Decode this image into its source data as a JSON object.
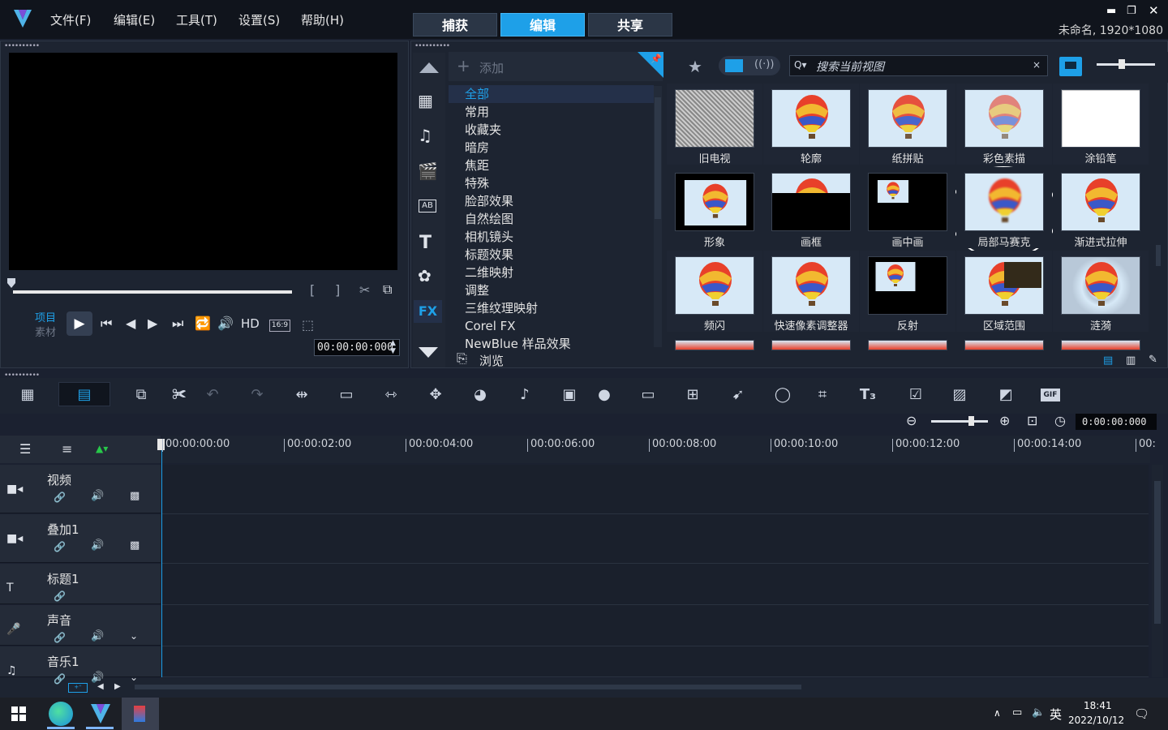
{
  "app": {
    "logo": "V",
    "title": "未命名, 1920*1080"
  },
  "menu": [
    "文件(F)",
    "编辑(E)",
    "工具(T)",
    "设置(S)",
    "帮助(H)"
  ],
  "modes": [
    {
      "label": "捕获",
      "active": false
    },
    {
      "label": "编辑",
      "active": true
    },
    {
      "label": "共享",
      "active": false
    }
  ],
  "window_controls": [
    "minimize-icon",
    "restore-icon",
    "close-icon"
  ],
  "player": {
    "project_label": "项目",
    "clip_label": "素材",
    "timecode": "00:00:00:000",
    "hd": "HD",
    "aspect": "16:9"
  },
  "library": {
    "add_label": "添加",
    "browse_label": "浏览",
    "categories": [
      "全部",
      "常用",
      "收藏夹",
      "暗房",
      "焦距",
      "特殊",
      "脸部效果",
      "自然绘图",
      "相机镜头",
      "标题效果",
      "二维映射",
      "调整",
      "三维纹理映射",
      "Corel FX",
      "NewBlue 样品效果"
    ],
    "selected_category": "全部",
    "search_placeholder": "搜索当前视图",
    "fx_label": "FX",
    "thumbnails": [
      {
        "label": "旧电视",
        "style": "noise"
      },
      {
        "label": "轮廓",
        "style": "balloon"
      },
      {
        "label": "纸拼贴",
        "style": "paper"
      },
      {
        "label": "彩色素描",
        "style": "sketch"
      },
      {
        "label": "涂铅笔",
        "style": "pencil"
      },
      {
        "label": "形象",
        "style": "framed"
      },
      {
        "label": "画框",
        "style": "letterbox"
      },
      {
        "label": "画中画",
        "style": "pip"
      },
      {
        "label": "局部马赛克",
        "style": "mosaic"
      },
      {
        "label": "渐进式拉伸",
        "style": "balloon"
      },
      {
        "label": "频闪",
        "style": "balloon"
      },
      {
        "label": "快速像素调整器",
        "style": "balloon"
      },
      {
        "label": "反射",
        "style": "reflect"
      },
      {
        "label": "区域范围",
        "style": "region"
      },
      {
        "label": "涟漪",
        "style": "ripple"
      }
    ]
  },
  "timeline": {
    "timecode": "0:00:00:000",
    "ruler": [
      "00:00:00:00",
      "00:00:02:00",
      "00:00:04:00",
      "00:00:06:00",
      "00:00:08:00",
      "00:00:10:00",
      "00:00:12:00",
      "00:00:14:00",
      "00:"
    ],
    "tracks": [
      {
        "name": "视频",
        "icon": "video-camera-icon"
      },
      {
        "name": "叠加1",
        "icon": "overlay-camera-icon"
      },
      {
        "name": "标题1",
        "icon": "title-t-icon"
      },
      {
        "name": "声音",
        "icon": "microphone-icon"
      },
      {
        "name": "音乐1",
        "icon": "music-note-icon"
      }
    ]
  },
  "taskbar": {
    "time": "18:41",
    "date": "2022/10/12",
    "ime": "英"
  },
  "colors": {
    "accent": "#1ea0e8",
    "background": "#1b2130"
  }
}
